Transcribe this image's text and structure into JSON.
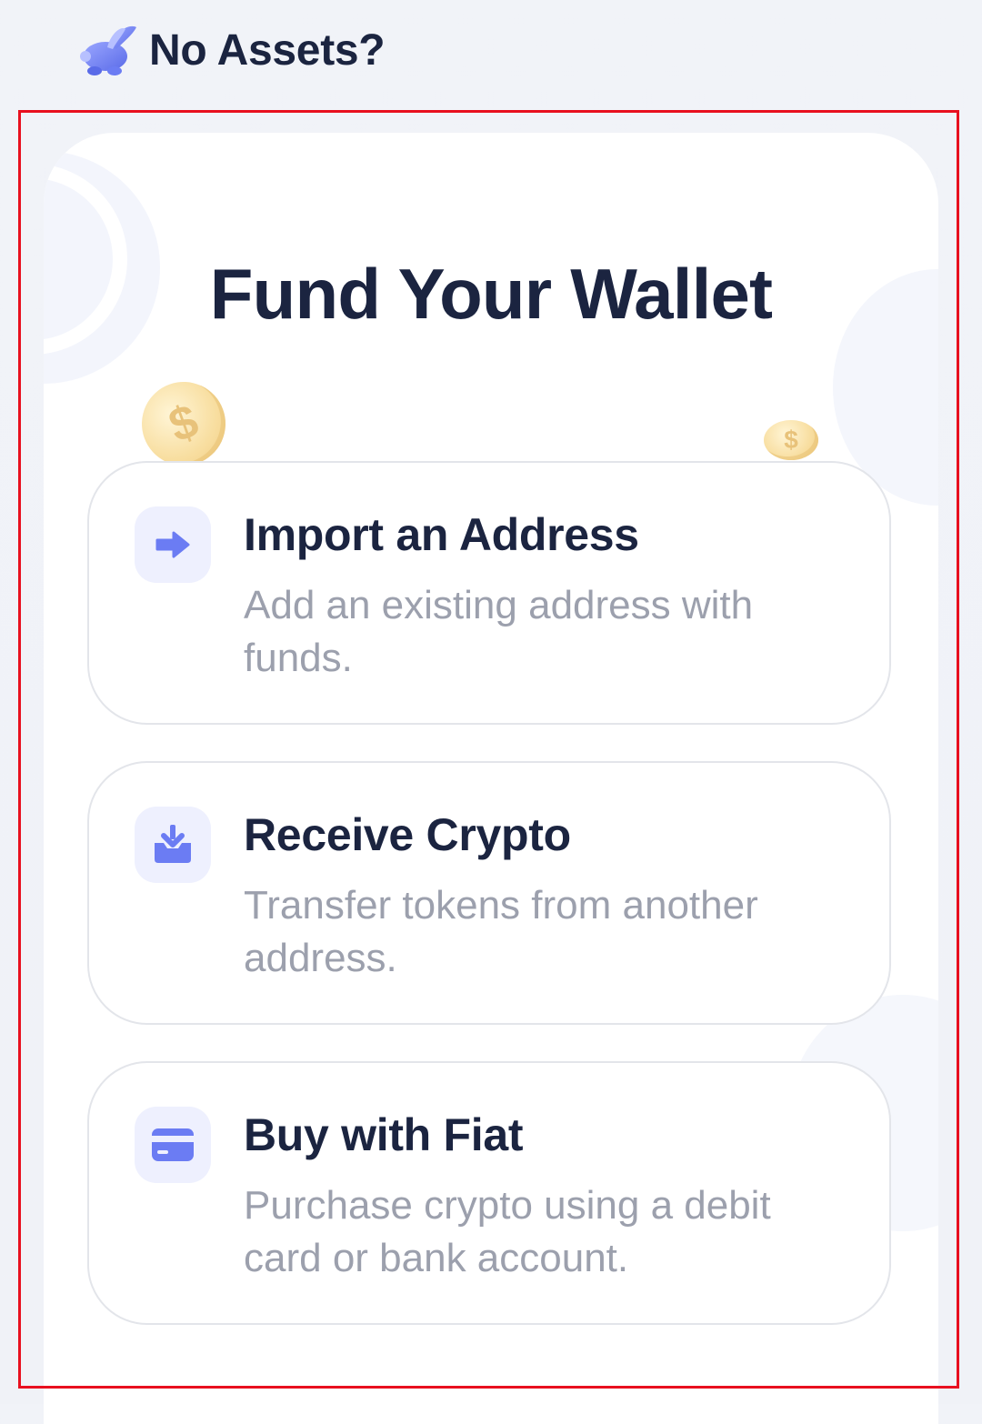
{
  "header": {
    "title": "No Assets?",
    "logo_icon": "rabbit-logo-icon"
  },
  "card": {
    "title": "Fund Your Wallet",
    "options": [
      {
        "title": "Import an Address",
        "description": "Add an existing address with funds.",
        "icon": "arrow-right-icon"
      },
      {
        "title": "Receive Crypto",
        "description": "Transfer tokens from another address.",
        "icon": "download-tray-icon"
      },
      {
        "title": "Buy with Fiat",
        "description": "Purchase crypto using a debit card or bank account.",
        "icon": "credit-card-icon"
      }
    ]
  },
  "colors": {
    "accent": "#6b7cf3",
    "icon_bg": "#eef0fe",
    "title_text": "#1b2440",
    "desc_text": "#9ca0ad",
    "highlight": "#e8101f"
  }
}
